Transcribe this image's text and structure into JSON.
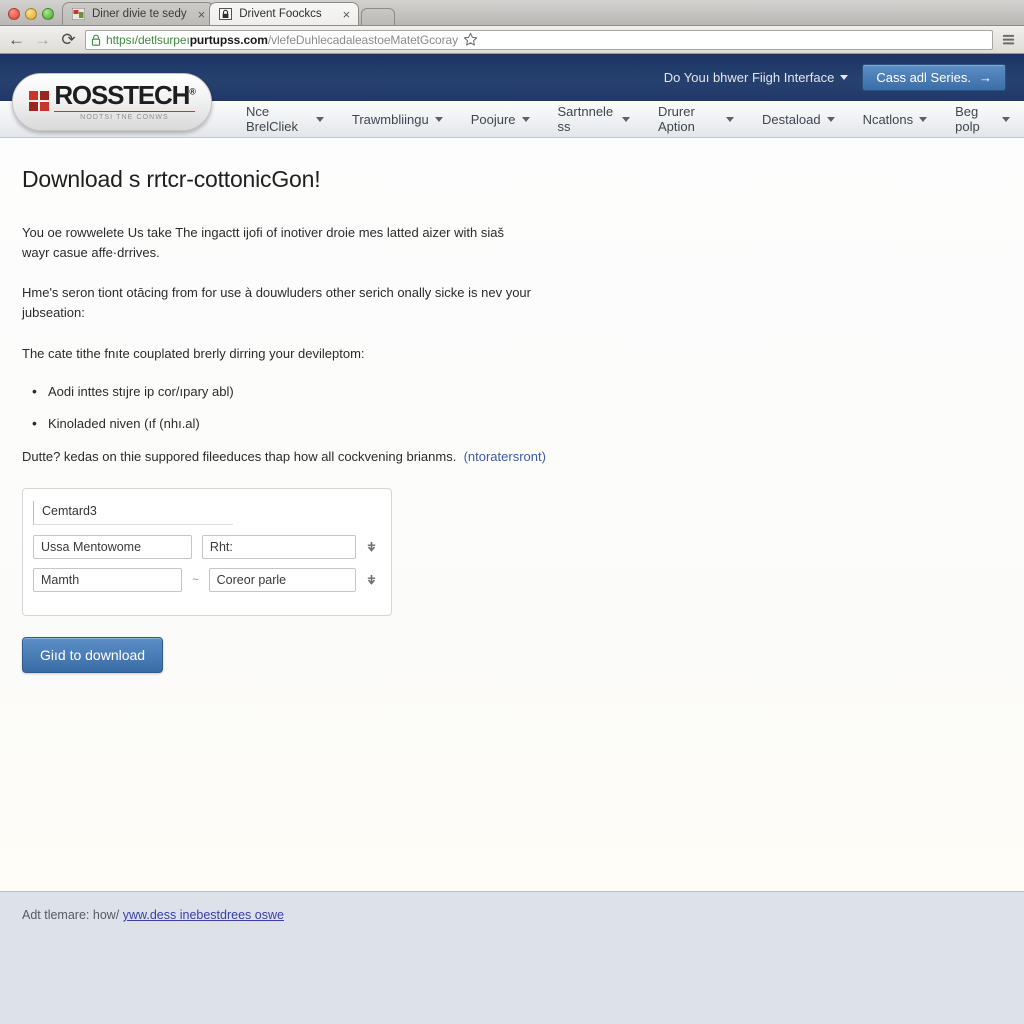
{
  "browser": {
    "tabs": [
      {
        "title": "Diner divie te sedy",
        "favicon": "image-icon",
        "active": false,
        "close_label": "×"
      },
      {
        "title": "Drivent Foockcs",
        "favicon": "lock-icon",
        "active": true,
        "close_label": "×"
      }
    ],
    "new_tab_label": "",
    "nav": {
      "back": "←",
      "forward": "→",
      "reload": "⟳"
    },
    "omnibox": {
      "scheme": "httpsı/detlsurpeı",
      "host": "purtupss.com",
      "path": "/vlefeDuhlecadaleastoeMatetGcoray",
      "lock": "lock-icon",
      "star": "star-icon",
      "menu": "menu-icon"
    }
  },
  "site": {
    "logo": {
      "word": "ROSSTECH",
      "trademark": "®",
      "tagline": "NODTSI TNE CONWS"
    },
    "top_bar": {
      "link": "Do Youı bhwer Fiigh Interface",
      "cta": "Cass adl Series.",
      "cta_arrow": "→"
    },
    "nav_items": [
      "Nce BrelCliek",
      "Trawmbliingu",
      "Poojure",
      "Sartnnele ss",
      "Drurer Aption",
      "Destaload",
      "Ncatlons",
      "Beg polp"
    ]
  },
  "main": {
    "title": "Download s rrtcr-cottonicGon!",
    "paragraph_1": "You oe rowwelete Us take The ingactt ijofi of inotiver droie mes latted aizer with siaš wayr casue affe·drrives.",
    "paragraph_2": "Hme's seron tiont otācing from for use à douwluders other serich onally sicke is nev your jubseation:",
    "paragraph_3": "The cate tithe fnıte couplated brerly dirring your devileptom:",
    "bullets": [
      "Aodi inttes stıjre ip cor/ıpary abl)",
      "Kinoladed niven (ıf (nhı.al)"
    ],
    "note_text": "Dutte? kedas on thie suppored fileeduces thap how all cockvening brianms.",
    "note_link": "(ntoratersront)",
    "form": {
      "title_field": "Cemtard3",
      "row1": {
        "left": "Ussa Mentowome",
        "right": "Rht:",
        "spinner": "spinner-icon"
      },
      "row2": {
        "left": "Mamth",
        "separator": "~",
        "right": "Coreor parle",
        "spinner": "spinner-icon"
      }
    },
    "download_button": "Giıd to download"
  },
  "footer": {
    "prefix": "Adt tlemare: how/",
    "link": "yww.dess inebestdrees oswe"
  },
  "colors": {
    "header_blue": "#27416f",
    "cta_blue": "#3c6da8",
    "button_blue": "#3a6ca6",
    "link_blue": "#3b5ca8",
    "footer_bg": "#dde1ea",
    "logo_red": "#c9342b"
  }
}
